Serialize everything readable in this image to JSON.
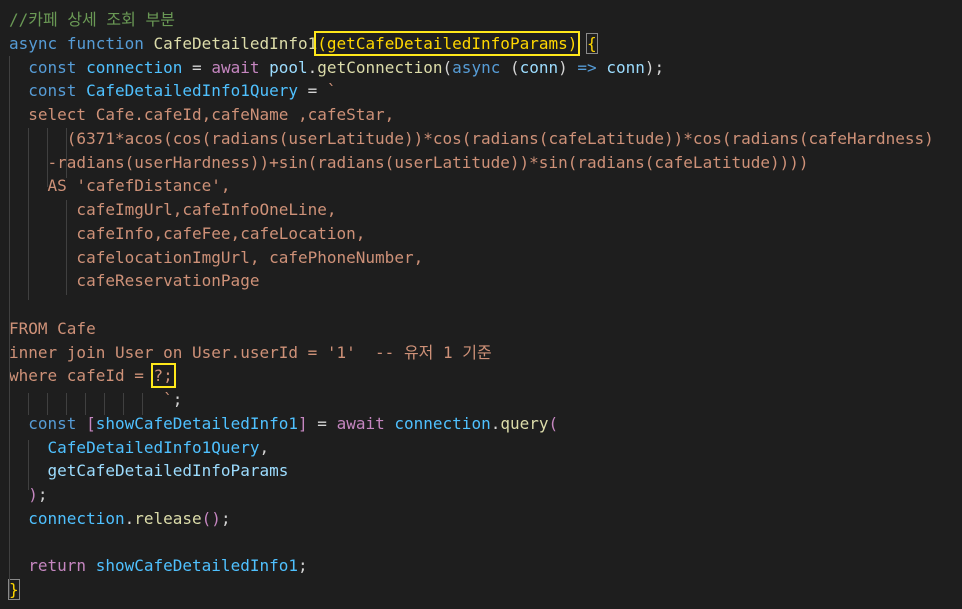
{
  "editor": {
    "colors": {
      "background": "#1e1e1e",
      "highlight_box": "#ffe81a",
      "comment": "#6a9955",
      "keyword": "#569cd6",
      "function": "#dcdcaa",
      "variable": "#9cdcfe",
      "string": "#ce9178"
    },
    "lines": [
      [
        {
          "c": "c-cmt",
          "t": "//카페 상세 조회 부분"
        }
      ],
      [
        {
          "c": "c-kw",
          "t": "async"
        },
        {
          "c": "c-pun",
          "t": " "
        },
        {
          "c": "c-kw",
          "t": "function"
        },
        {
          "c": "c-pun",
          "t": " "
        },
        {
          "c": "c-fn",
          "t": "CafeDetailedInfo1"
        },
        {
          "c": "c-brk hl",
          "t": "(getCafeDetailedInfoParams)",
          "name": "highlighted-params"
        },
        {
          "c": "c-pun",
          "t": " "
        },
        {
          "c": "c-brk br",
          "t": "{",
          "name": "matched-brace"
        }
      ],
      [
        {
          "c": "c-pun",
          "t": "  "
        },
        {
          "c": "c-kw",
          "t": "const"
        },
        {
          "c": "c-pun",
          "t": " "
        },
        {
          "c": "c-const",
          "t": "connection"
        },
        {
          "c": "c-pun",
          "t": " = "
        },
        {
          "c": "c-ctl",
          "t": "await"
        },
        {
          "c": "c-pun",
          "t": " "
        },
        {
          "c": "c-var",
          "t": "pool"
        },
        {
          "c": "c-pun",
          "t": "."
        },
        {
          "c": "c-fn",
          "t": "getConnection"
        },
        {
          "c": "c-pun",
          "t": "("
        },
        {
          "c": "c-kw",
          "t": "async"
        },
        {
          "c": "c-pun",
          "t": " ("
        },
        {
          "c": "c-var",
          "t": "conn"
        },
        {
          "c": "c-pun",
          "t": ") "
        },
        {
          "c": "c-kw",
          "t": "=>"
        },
        {
          "c": "c-pun",
          "t": " "
        },
        {
          "c": "c-var",
          "t": "conn"
        },
        {
          "c": "c-pun",
          "t": ");"
        }
      ],
      [
        {
          "c": "c-pun",
          "t": "  "
        },
        {
          "c": "c-kw",
          "t": "const"
        },
        {
          "c": "c-pun",
          "t": " "
        },
        {
          "c": "c-const",
          "t": "CafeDetailedInfo1Query"
        },
        {
          "c": "c-pun",
          "t": " = "
        },
        {
          "c": "c-str",
          "t": "`"
        }
      ],
      [
        {
          "c": "c-str",
          "t": "  select Cafe.cafeId,cafeName ,cafeStar,"
        }
      ],
      [
        {
          "c": "c-str",
          "t": "      (6371*acos(cos(radians(userLatitude))*cos(radians(cafeLatitude))*cos(radians(cafeHardness)"
        }
      ],
      [
        {
          "c": "c-str",
          "t": "    -radians(userHardness))+sin(radians(userLatitude))*sin(radians(cafeLatitude))))"
        }
      ],
      [
        {
          "c": "c-str",
          "t": "    AS 'cafefDistance',"
        }
      ],
      [
        {
          "c": "c-str",
          "t": "       cafeImgUrl,cafeInfoOneLine,"
        }
      ],
      [
        {
          "c": "c-str",
          "t": "       cafeInfo,cafeFee,cafeLocation,"
        }
      ],
      [
        {
          "c": "c-str",
          "t": "       cafelocationImgUrl, cafePhoneNumber,"
        }
      ],
      [
        {
          "c": "c-str",
          "t": "       cafeReservationPage"
        }
      ],
      [
        {
          "c": "c-str",
          "t": " "
        }
      ],
      [
        {
          "c": "c-str",
          "t": "FROM Cafe"
        }
      ],
      [
        {
          "c": "c-str",
          "t": "inner join User on User.userId = '1'  -- 유저 1 기준"
        }
      ],
      [
        {
          "c": "c-str",
          "t": "where cafeId = "
        },
        {
          "c": "c-str hl",
          "t": "?;",
          "name": "highlighted-placeholder"
        }
      ],
      [
        {
          "c": "c-str",
          "t": "                `"
        },
        {
          "c": "c-pun",
          "t": ";"
        }
      ],
      [
        {
          "c": "c-pun",
          "t": "  "
        },
        {
          "c": "c-kw",
          "t": "const"
        },
        {
          "c": "c-pun",
          "t": " "
        },
        {
          "c": "c-ctl",
          "t": "["
        },
        {
          "c": "c-const",
          "t": "showCafeDetailedInfo1"
        },
        {
          "c": "c-ctl",
          "t": "]"
        },
        {
          "c": "c-pun",
          "t": " = "
        },
        {
          "c": "c-ctl",
          "t": "await"
        },
        {
          "c": "c-pun",
          "t": " "
        },
        {
          "c": "c-const",
          "t": "connection"
        },
        {
          "c": "c-pun",
          "t": "."
        },
        {
          "c": "c-fn",
          "t": "query"
        },
        {
          "c": "c-ctl",
          "t": "("
        }
      ],
      [
        {
          "c": "c-pun",
          "t": "    "
        },
        {
          "c": "c-const",
          "t": "CafeDetailedInfo1Query"
        },
        {
          "c": "c-pun",
          "t": ","
        }
      ],
      [
        {
          "c": "c-pun",
          "t": "    "
        },
        {
          "c": "c-var",
          "t": "getCafeDetailedInfoParams"
        }
      ],
      [
        {
          "c": "c-pun",
          "t": "  "
        },
        {
          "c": "c-ctl",
          "t": ")"
        },
        {
          "c": "c-pun",
          "t": ";"
        }
      ],
      [
        {
          "c": "c-pun",
          "t": "  "
        },
        {
          "c": "c-const",
          "t": "connection"
        },
        {
          "c": "c-pun",
          "t": "."
        },
        {
          "c": "c-fn",
          "t": "release"
        },
        {
          "c": "c-ctl",
          "t": "()"
        },
        {
          "c": "c-pun",
          "t": ";"
        }
      ],
      [
        {
          "c": "c-pun",
          "t": " "
        }
      ],
      [
        {
          "c": "c-pun",
          "t": "  "
        },
        {
          "c": "c-ctl",
          "t": "return"
        },
        {
          "c": "c-pun",
          "t": " "
        },
        {
          "c": "c-const",
          "t": "showCafeDetailedInfo1"
        },
        {
          "c": "c-pun",
          "t": ";"
        }
      ],
      [
        {
          "c": "c-brk br",
          "t": "}",
          "name": "closing-brace"
        }
      ]
    ]
  }
}
